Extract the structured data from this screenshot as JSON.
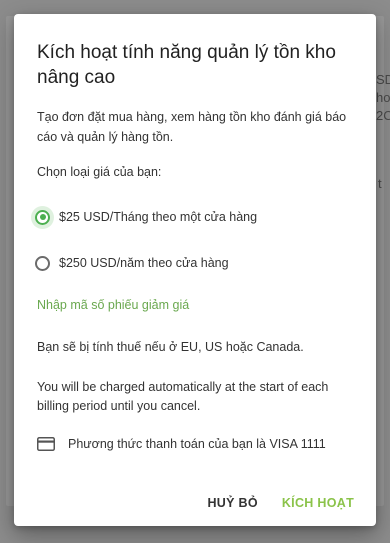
{
  "background": {
    "fragments": [
      "SD",
      "ho",
      "2C",
      "t"
    ]
  },
  "dialog": {
    "title": "Kích hoạt tính năng quản lý tồn kho nâng cao",
    "description": "Tạo đơn đặt mua hàng, xem hàng tồn kho đánh giá báo cáo và quản lý hàng tồn.",
    "price_label": "Chọn loại giá của bạn:",
    "options": [
      {
        "label": "$25 USD/Tháng theo một cửa hàng",
        "selected": true
      },
      {
        "label": "$250 USD/năm theo cửa hàng",
        "selected": false
      }
    ],
    "coupon_link": "Nhập mã số phiếu giảm giá",
    "tax_note": "Bạn sẽ bị tính thuế nếu ở EU, US hoặc Canada.",
    "charge_note": "You will be charged automatically at the start of each billing period until you cancel.",
    "payment_method": "Phương thức thanh toán của bạn là VISA 1111",
    "payment_icon": "credit-card-icon",
    "buttons": {
      "cancel": "HUỶ BỎ",
      "activate": "KÍCH HOẠT"
    }
  },
  "colors": {
    "accent": "#8bc34a",
    "radio_selected": "#4caf50",
    "link": "#6aa84f",
    "overlay": "#8c8c8c"
  }
}
